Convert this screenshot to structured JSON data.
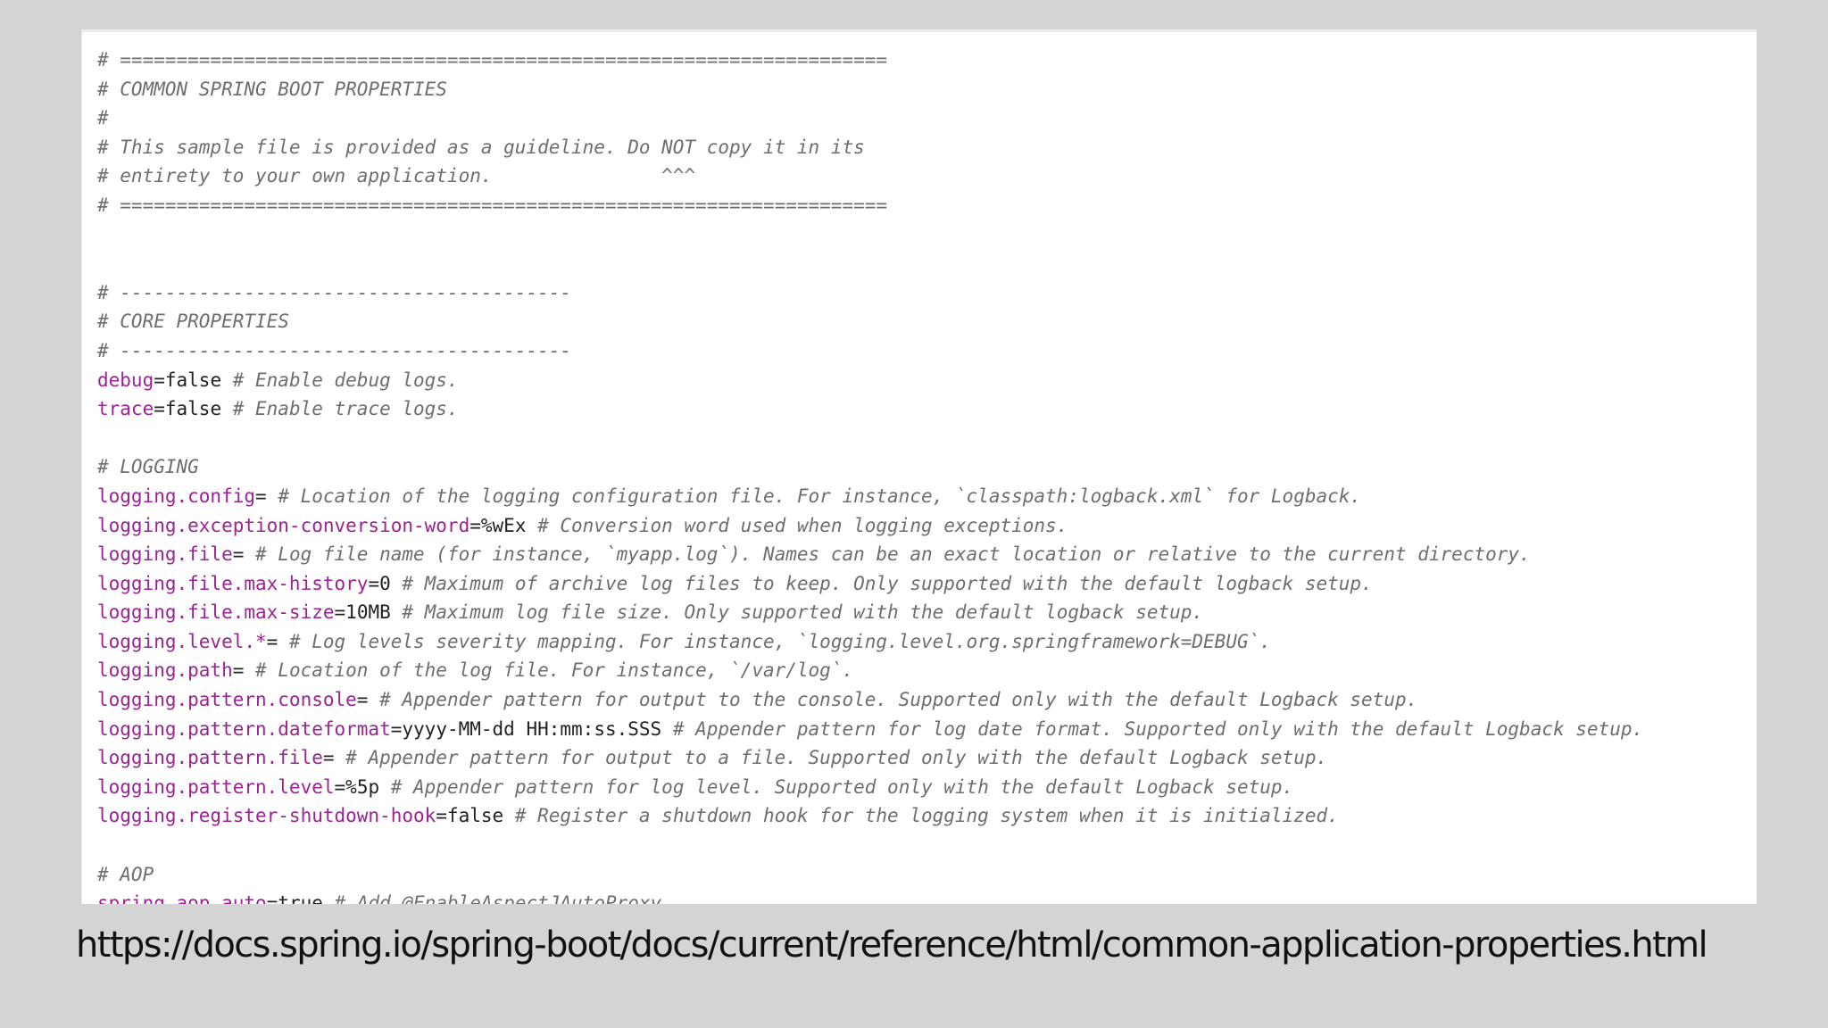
{
  "code": {
    "lines": [
      {
        "comment": "# ===================================================================="
      },
      {
        "comment": "# COMMON SPRING BOOT PROPERTIES"
      },
      {
        "comment": "#"
      },
      {
        "comment": "# This sample file is provided as a guideline. Do NOT copy it in its"
      },
      {
        "comment": "# entirety to your own application.               ^^^"
      },
      {
        "comment": "# ===================================================================="
      },
      {
        "comment": ""
      },
      {
        "comment": ""
      },
      {
        "comment": "# ----------------------------------------"
      },
      {
        "comment": "# CORE PROPERTIES"
      },
      {
        "comment": "# ----------------------------------------"
      },
      {
        "key": "debug",
        "value": "false",
        "comment": " # Enable debug logs."
      },
      {
        "key": "trace",
        "value": "false",
        "comment": " # Enable trace logs."
      },
      {
        "comment": ""
      },
      {
        "comment": "# LOGGING"
      },
      {
        "key": "logging.config",
        "value": "",
        "comment": " # Location of the logging configuration file. For instance, `classpath:logback.xml` for Logback."
      },
      {
        "key": "logging.exception-conversion-word",
        "value": "%wEx",
        "comment": " # Conversion word used when logging exceptions."
      },
      {
        "key": "logging.file",
        "value": "",
        "comment": " # Log file name (for instance, `myapp.log`). Names can be an exact location or relative to the current directory."
      },
      {
        "key": "logging.file.max-history",
        "value": "0",
        "comment": " # Maximum of archive log files to keep. Only supported with the default logback setup."
      },
      {
        "key": "logging.file.max-size",
        "value": "10MB",
        "comment": " # Maximum log file size. Only supported with the default logback setup."
      },
      {
        "key": "logging.level.*",
        "value": "",
        "comment": " # Log levels severity mapping. For instance, `logging.level.org.springframework=DEBUG`."
      },
      {
        "key": "logging.path",
        "value": "",
        "comment": " # Location of the log file. For instance, `/var/log`."
      },
      {
        "key": "logging.pattern.console",
        "value": "",
        "comment": " # Appender pattern for output to the console. Supported only with the default Logback setup."
      },
      {
        "key": "logging.pattern.dateformat",
        "value": "yyyy-MM-dd HH:mm:ss.SSS",
        "comment": " # Appender pattern for log date format. Supported only with the default Logback setup."
      },
      {
        "key": "logging.pattern.file",
        "value": "",
        "comment": " # Appender pattern for output to a file. Supported only with the default Logback setup."
      },
      {
        "key": "logging.pattern.level",
        "value": "%5p",
        "comment": " # Appender pattern for log level. Supported only with the default Logback setup."
      },
      {
        "key": "logging.register-shutdown-hook",
        "value": "false",
        "comment": " # Register a shutdown hook for the logging system when it is initialized."
      },
      {
        "comment": ""
      },
      {
        "comment": "# AOP"
      },
      {
        "key": "spring.aop.auto",
        "value": "true",
        "comment": " # Add @EnableAspectJAutoProxy."
      }
    ]
  },
  "source_url": "https://docs.spring.io/spring-boot/docs/current/reference/html/common-application-properties.html"
}
